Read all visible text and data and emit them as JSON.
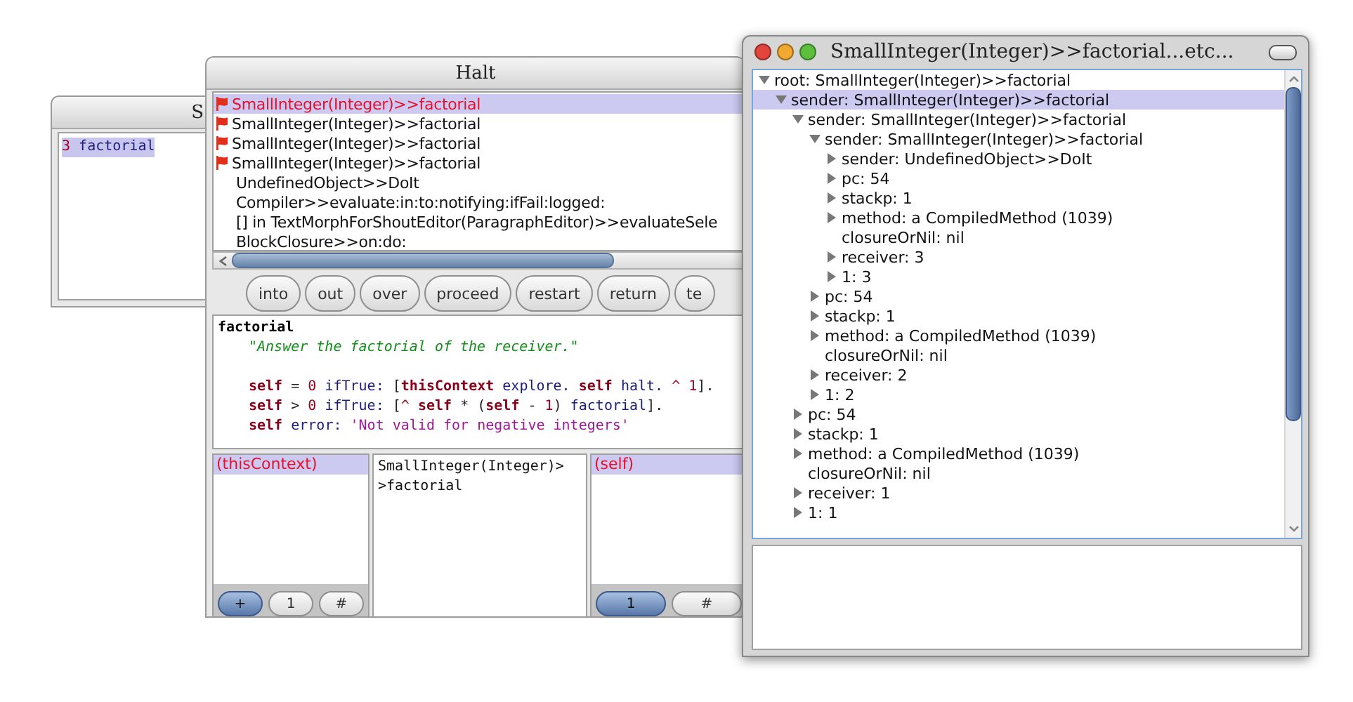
{
  "workspace": {
    "title": "S",
    "text": {
      "selected": true,
      "tokens": [
        {
          "kind": "num",
          "text": "3"
        },
        {
          "kind": "sel",
          "text": " factorial"
        }
      ]
    }
  },
  "debugger": {
    "title": "Halt",
    "stack": [
      {
        "label": "SmallInteger(Integer)>>factorial",
        "flagged": true,
        "selected": true
      },
      {
        "label": "SmallInteger(Integer)>>factorial",
        "flagged": true,
        "selected": false
      },
      {
        "label": "SmallInteger(Integer)>>factorial",
        "flagged": true,
        "selected": false
      },
      {
        "label": "SmallInteger(Integer)>>factorial",
        "flagged": true,
        "selected": false
      },
      {
        "label": "UndefinedObject>>DoIt",
        "flagged": false,
        "selected": false
      },
      {
        "label": "Compiler>>evaluate:in:to:notifying:ifFail:logged:",
        "flagged": false,
        "selected": false
      },
      {
        "label": "[] in TextMorphForShoutEditor(ParagraphEditor)>>evaluateSele",
        "flagged": false,
        "selected": false
      },
      {
        "label": "BlockClosure>>on:do:",
        "flagged": false,
        "selected": false
      }
    ],
    "buttons": [
      "into",
      "out",
      "over",
      "proceed",
      "restart",
      "return",
      "te"
    ],
    "code": [
      {
        "kind": "header",
        "tokens": [
          {
            "kind": "bold",
            "text": "factorial"
          }
        ]
      },
      {
        "kind": "body",
        "tokens": [
          {
            "kind": "cmt",
            "text": "\"Answer the factorial of the receiver.\""
          }
        ]
      },
      {
        "kind": "blank"
      },
      {
        "kind": "body",
        "tokens": [
          {
            "kind": "kw",
            "text": "self"
          },
          {
            "kind": "plain",
            "text": " = "
          },
          {
            "kind": "num",
            "text": "0"
          },
          {
            "kind": "sel",
            "text": " ifTrue: "
          },
          {
            "kind": "plain",
            "text": "["
          },
          {
            "kind": "kw",
            "text": "thisContext"
          },
          {
            "kind": "sel",
            "text": " explore. "
          },
          {
            "kind": "kw",
            "text": "self"
          },
          {
            "kind": "sel",
            "text": " halt. "
          },
          {
            "kind": "num",
            "text": "^ 1"
          },
          {
            "kind": "plain",
            "text": "]."
          }
        ]
      },
      {
        "kind": "body",
        "tokens": [
          {
            "kind": "kw",
            "text": "self"
          },
          {
            "kind": "plain",
            "text": " > "
          },
          {
            "kind": "num",
            "text": "0"
          },
          {
            "kind": "sel",
            "text": " ifTrue: "
          },
          {
            "kind": "plain",
            "text": "["
          },
          {
            "kind": "num",
            "text": "^ "
          },
          {
            "kind": "kw",
            "text": "self"
          },
          {
            "kind": "plain",
            "text": " * ("
          },
          {
            "kind": "kw",
            "text": "self"
          },
          {
            "kind": "plain",
            "text": " - "
          },
          {
            "kind": "num",
            "text": "1"
          },
          {
            "kind": "plain",
            "text": ") "
          },
          {
            "kind": "sel",
            "text": "factorial"
          },
          {
            "kind": "plain",
            "text": "]."
          }
        ]
      },
      {
        "kind": "body",
        "tokens": [
          {
            "kind": "kw",
            "text": "self"
          },
          {
            "kind": "sel",
            "text": " error: "
          },
          {
            "kind": "str",
            "text": "'Not valid for negative integers'"
          }
        ]
      }
    ],
    "context_inspector": {
      "fields": [
        {
          "label": "(thisContext)",
          "selected": true
        }
      ],
      "buttons": [
        {
          "label": "+",
          "selected": true
        },
        {
          "label": "1",
          "selected": false
        },
        {
          "label": "#",
          "selected": false
        }
      ]
    },
    "context_value": "SmallInteger(Integer)>\n>factorial",
    "receiver_inspector": {
      "fields": [
        {
          "label": "(self)",
          "selected": true
        }
      ],
      "buttons": [
        {
          "label": "1",
          "selected": true
        },
        {
          "label": "#",
          "selected": false
        }
      ]
    }
  },
  "explorer": {
    "title": "SmallInteger(Integer)>>factorial...etc...",
    "tree": [
      {
        "label": "root: SmallInteger(Integer)>>factorial",
        "kind": "branch",
        "expanded": true,
        "selected": false,
        "children": [
          {
            "label": "sender: SmallInteger(Integer)>>factorial",
            "kind": "branch",
            "expanded": true,
            "selected": true,
            "children": [
              {
                "label": "sender: SmallInteger(Integer)>>factorial",
                "kind": "branch",
                "expanded": true,
                "selected": false,
                "children": [
                  {
                    "label": "sender: SmallInteger(Integer)>>factorial",
                    "kind": "branch",
                    "expanded": true,
                    "selected": false,
                    "children": [
                      {
                        "label": "sender: UndefinedObject>>DoIt",
                        "kind": "branch",
                        "expanded": false,
                        "selected": false
                      },
                      {
                        "label": "pc: 54",
                        "kind": "branch",
                        "expanded": false,
                        "selected": false
                      },
                      {
                        "label": "stackp: 1",
                        "kind": "branch",
                        "expanded": false,
                        "selected": false
                      },
                      {
                        "label": "method: a CompiledMethod (1039)",
                        "kind": "branch",
                        "expanded": false,
                        "selected": false
                      },
                      {
                        "label": "closureOrNil: nil",
                        "kind": "leaf",
                        "selected": false
                      },
                      {
                        "label": "receiver: 3",
                        "kind": "branch",
                        "expanded": false,
                        "selected": false
                      },
                      {
                        "label": "1: 3",
                        "kind": "branch",
                        "expanded": false,
                        "selected": false
                      }
                    ]
                  },
                  {
                    "label": "pc: 54",
                    "kind": "branch",
                    "expanded": false,
                    "selected": false
                  },
                  {
                    "label": "stackp: 1",
                    "kind": "branch",
                    "expanded": false,
                    "selected": false
                  },
                  {
                    "label": "method: a CompiledMethod (1039)",
                    "kind": "branch",
                    "expanded": false,
                    "selected": false
                  },
                  {
                    "label": "closureOrNil: nil",
                    "kind": "leaf",
                    "selected": false
                  },
                  {
                    "label": "receiver: 2",
                    "kind": "branch",
                    "expanded": false,
                    "selected": false
                  },
                  {
                    "label": "1: 2",
                    "kind": "branch",
                    "expanded": false,
                    "selected": false
                  }
                ]
              },
              {
                "label": "pc: 54",
                "kind": "branch",
                "expanded": false,
                "selected": false
              },
              {
                "label": "stackp: 1",
                "kind": "branch",
                "expanded": false,
                "selected": false
              },
              {
                "label": "method: a CompiledMethod (1039)",
                "kind": "branch",
                "expanded": false,
                "selected": false
              },
              {
                "label": "closureOrNil: nil",
                "kind": "leaf",
                "selected": false
              },
              {
                "label": "receiver: 1",
                "kind": "branch",
                "expanded": false,
                "selected": false
              },
              {
                "label": "1: 1",
                "kind": "branch",
                "expanded": false,
                "selected": false
              }
            ]
          }
        ]
      }
    ]
  }
}
